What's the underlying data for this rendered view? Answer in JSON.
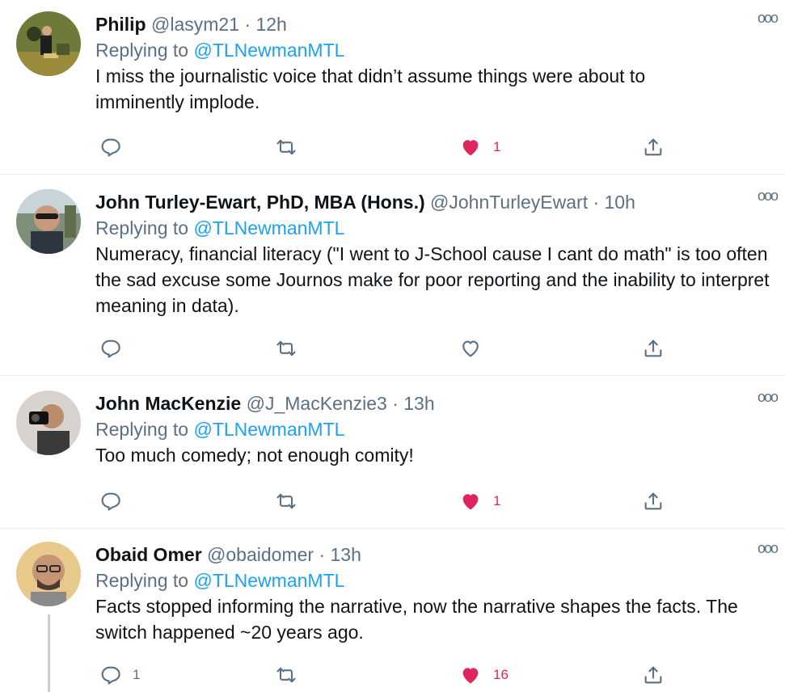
{
  "colors": {
    "link": "#1da1f2",
    "muted": "#5b7083",
    "like": "#e0245e",
    "divider": "#e6ecf0"
  },
  "tweets": [
    {
      "name": "Philip",
      "handle": "@lasym21",
      "time": "· 12h",
      "reply_label": "Replying to",
      "reply_handle": "@TLNewmanMTL",
      "text": "I miss the journalistic voice that didn’t assume things were about to imminently implode.",
      "reply_count": "",
      "retweet_count": "",
      "like_count": "1",
      "liked": true,
      "avatar_icon": "person-outdoors-avatar"
    },
    {
      "name": "John Turley-Ewart, PhD, MBA (Hons.)",
      "handle": "@JohnTurleyEwart",
      "time": "· 10h",
      "reply_label": "Replying to",
      "reply_handle": "@TLNewmanMTL",
      "text": "Numeracy, financial literacy (\"I went to J-School cause I cant do math\" is too often the sad excuse some Journos make for poor reporting and the inability to interpret meaning in data).",
      "reply_count": "",
      "retweet_count": "",
      "like_count": "",
      "liked": false,
      "avatar_icon": "person-sunglasses-avatar"
    },
    {
      "name": "John MacKenzie",
      "handle": "@J_MacKenzie3",
      "time": "· 13h",
      "reply_label": "Replying to",
      "reply_handle": "@TLNewmanMTL",
      "text": "Too much comedy; not enough comity!",
      "reply_count": "",
      "retweet_count": "",
      "like_count": "1",
      "liked": true,
      "avatar_icon": "person-camera-avatar"
    },
    {
      "name": "Obaid Omer",
      "handle": "@obaidomer",
      "time": "· 13h",
      "reply_label": "Replying to",
      "reply_handle": "@TLNewmanMTL",
      "text": "Facts stopped informing the narrative, now the narrative shapes the facts. The switch happened ~20 years ago.",
      "reply_count": "1",
      "retweet_count": "",
      "like_count": "16",
      "liked": true,
      "avatar_icon": "person-glasses-avatar"
    }
  ],
  "more_glyph": "ooo"
}
